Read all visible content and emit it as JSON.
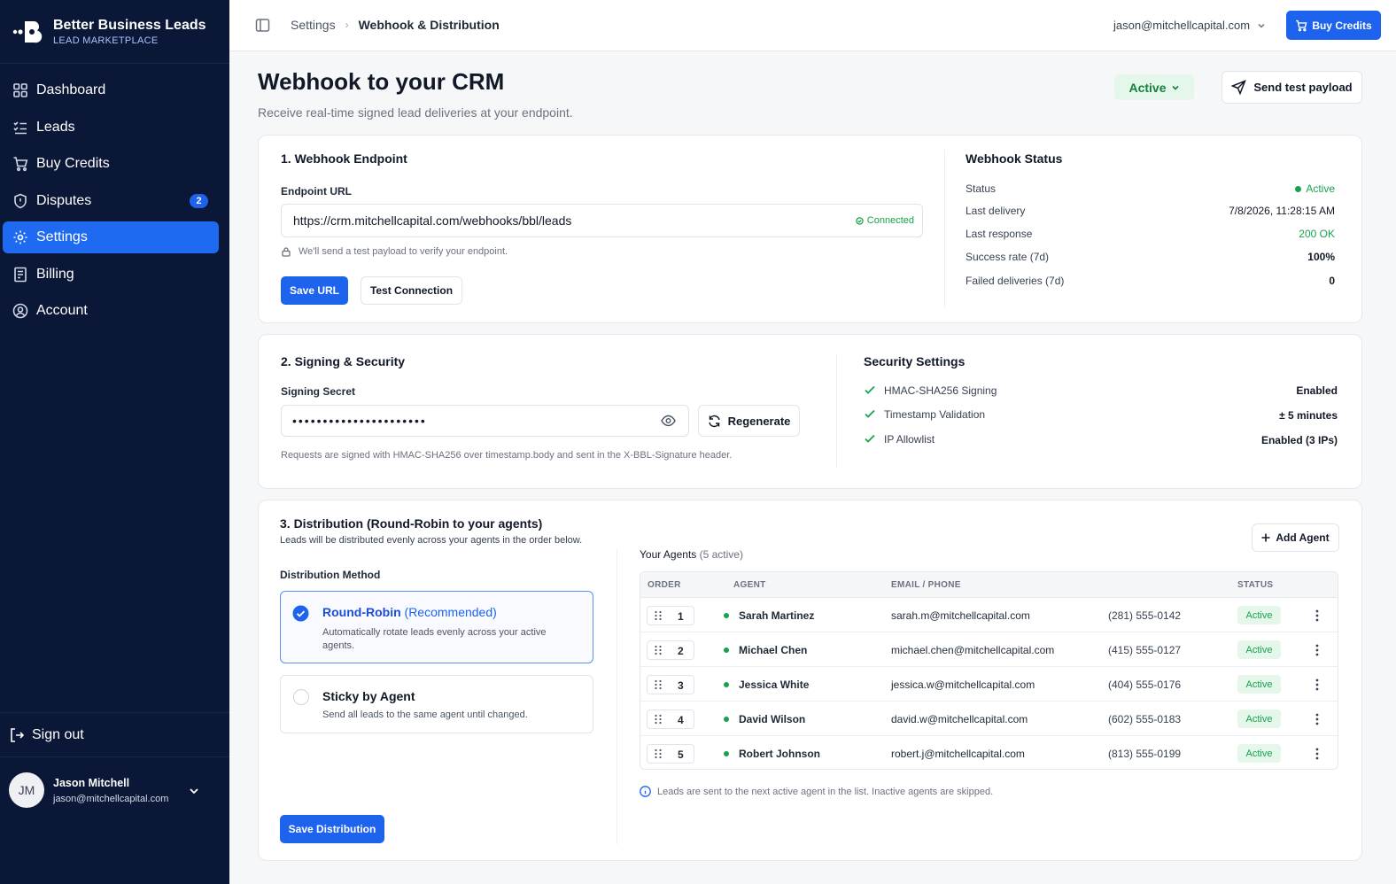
{
  "brand": {
    "title": "Better Business Leads",
    "subtitle": "LEAD MARKETPLACE"
  },
  "sidebar": {
    "items": [
      {
        "label": "Dashboard",
        "icon": "dashboard-icon"
      },
      {
        "label": "Leads",
        "icon": "list-check-icon"
      },
      {
        "label": "Buy Credits",
        "icon": "cart-icon"
      },
      {
        "label": "Disputes",
        "icon": "shield-icon",
        "badge": "2"
      },
      {
        "label": "Settings",
        "icon": "gear-icon",
        "active": true
      },
      {
        "label": "Billing",
        "icon": "receipt-icon"
      },
      {
        "label": "Account",
        "icon": "user-circle-icon"
      }
    ],
    "sign_out": "Sign out",
    "user": {
      "initials": "JM",
      "name": "Jason Mitchell",
      "email": "jason@mitchellcapital.com"
    }
  },
  "topbar": {
    "breadcrumb": [
      "Settings",
      "Webhook & Distribution"
    ],
    "account": "jason@mitchellcapital.com",
    "buy_label": "Buy Credits"
  },
  "page": {
    "title": "Webhook to your CRM",
    "subtitle": "Receive real-time signed lead deliveries at your endpoint.",
    "status": "Active",
    "send_test": "Send test payload"
  },
  "endpoint": {
    "section_title": "1.  Webhook Endpoint",
    "url_label": "Endpoint URL",
    "url_value": "https://crm.mitchellcapital.com/webhooks/bbl/leads",
    "connected": "Connected",
    "hint": "We'll send a test payload to verify your endpoint.",
    "save_label": "Save URL",
    "test_label": "Test Connection"
  },
  "webhook_status": {
    "title": "Webhook Status",
    "rows": [
      {
        "key": "Status",
        "value": "Active"
      },
      {
        "key": "Last delivery",
        "value": "7/8/2026, 11:28:15 AM"
      },
      {
        "key": "Last response",
        "value": "200 OK"
      },
      {
        "key": "Success rate (7d)",
        "value": "100%"
      },
      {
        "key": "Failed deliveries (7d)",
        "value": "0"
      }
    ]
  },
  "signing": {
    "section_title": "2. Signing & Security",
    "secret_label": "Signing Secret",
    "secret_value": "••••••••••••••••••••••",
    "regenerate": "Regenerate",
    "note": "Requests are signed with HMAC-SHA256 over timestamp.body and sent in the X-BBL-Signature header."
  },
  "security": {
    "title": "Security Settings",
    "rows": [
      {
        "key": "HMAC-SHA256 Signing",
        "value": "Enabled"
      },
      {
        "key": "Timestamp Validation",
        "value": "± 5 minutes"
      },
      {
        "key": "IP Allowlist",
        "value": "Enabled (3 IPs)"
      }
    ]
  },
  "distribution": {
    "section_title": "3. Distribution (Round-Robin to your agents)",
    "subtitle": "Leads will be distributed evenly across your agents in the order below.",
    "method_label": "Distribution Method",
    "options": [
      {
        "title": "Round-Robin",
        "tag": "(Recommended)",
        "desc": "Automatically rotate leads evenly across your active agents.",
        "selected": true
      },
      {
        "title": "Sticky by Agent",
        "tag": "",
        "desc": "Send all leads to the same agent until changed.",
        "selected": false
      }
    ],
    "save_label": "Save Distribution",
    "agents_label": "Your Agents",
    "agents_count": "(5 active)",
    "add_agent": "Add Agent",
    "columns": [
      "ORDER",
      "AGENT",
      "EMAIL / PHONE",
      "STATUS"
    ],
    "agents": [
      {
        "order": "1",
        "name": "Sarah Martinez",
        "email": "sarah.m@mitchellcapital.com",
        "phone": "(281) 555-0142",
        "status": "Active"
      },
      {
        "order": "2",
        "name": "Michael Chen",
        "email": "michael.chen@mitchellcapital.com",
        "phone": "(415) 555-0127",
        "status": "Active"
      },
      {
        "order": "3",
        "name": "Jessica White",
        "email": "jessica.w@mitchellcapital.com",
        "phone": "(404) 555-0176",
        "status": "Active"
      },
      {
        "order": "4",
        "name": "David Wilson",
        "email": "david.w@mitchellcapital.com",
        "phone": "(602) 555-0183",
        "status": "Active"
      },
      {
        "order": "5",
        "name": "Robert Johnson",
        "email": "robert.j@mitchellcapital.com",
        "phone": "(813) 555-0199",
        "status": "Active"
      }
    ],
    "info": "Leads are sent to the next active agent in the list. Inactive agents are skipped."
  },
  "colors": {
    "sidebar": "#0b1737",
    "accent": "#1d63ed",
    "success": "#16a34a"
  }
}
